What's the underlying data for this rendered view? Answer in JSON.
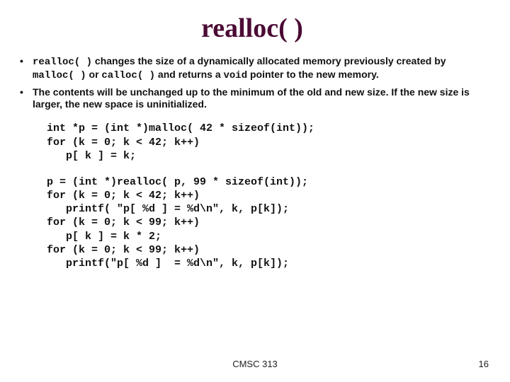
{
  "title": "realloc( )",
  "bullets": [
    {
      "parts": [
        {
          "t": "realloc( )",
          "mono": true
        },
        {
          "t": " changes the size of a dynamically allocated memory previously created by "
        },
        {
          "t": "malloc( )",
          "mono": true
        },
        {
          "t": " or "
        },
        {
          "t": "calloc( )",
          "mono": true
        },
        {
          "t": " and returns a "
        },
        {
          "t": "void",
          "mono": true
        },
        {
          "t": " pointer to the new memory."
        }
      ]
    },
    {
      "parts": [
        {
          "t": "The contents will be unchanged up to the minimum of the old and new size. If the new size is larger, the new space is uninitialized."
        }
      ]
    }
  ],
  "code1": "int *p = (int *)malloc( 42 * sizeof(int));\nfor (k = 0; k < 42; k++)\n   p[ k ] = k;",
  "code2": "p = (int *)realloc( p, 99 * sizeof(int));\nfor (k = 0; k < 42; k++)\n   printf( \"p[ %d ] = %d\\n\", k, p[k]);\nfor (k = 0; k < 99; k++)\n   p[ k ] = k * 2;\nfor (k = 0; k < 99; k++)\n   printf(\"p[ %d ]  = %d\\n\", k, p[k]);",
  "footer": {
    "course": "CMSC 313",
    "page": "16"
  }
}
